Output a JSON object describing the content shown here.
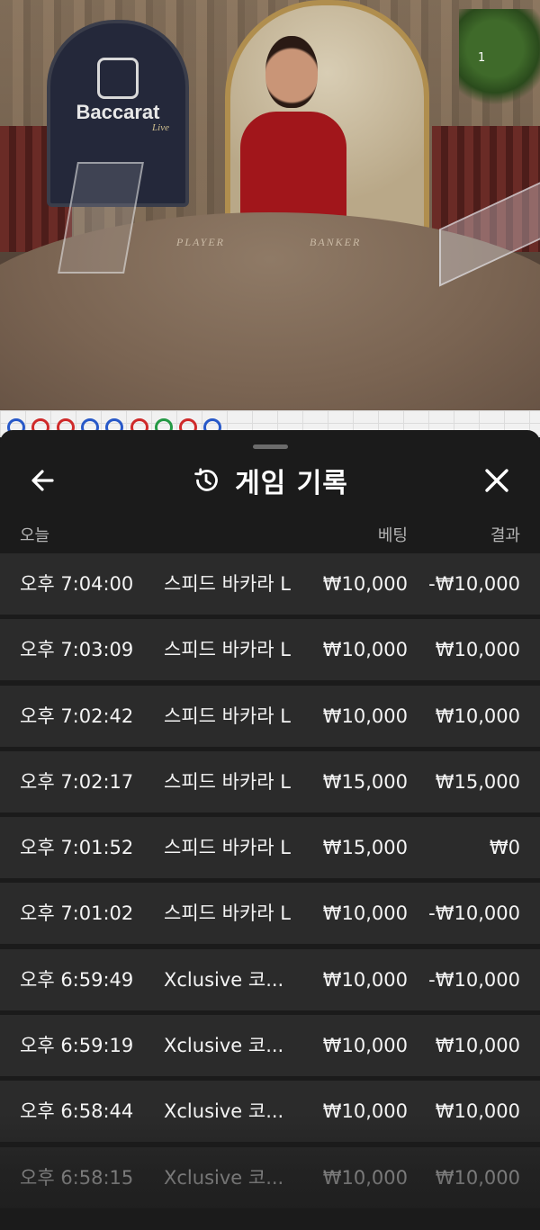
{
  "video": {
    "table_logo_text": "Baccarat",
    "table_logo_sub": "Live",
    "player_label": "PLAYER",
    "banker_label": "BANKER",
    "viewer_count": "1"
  },
  "bead_road": [
    "P",
    "B",
    "B",
    "P",
    "P",
    "B",
    "T",
    "B",
    "P"
  ],
  "colors": {
    "sheet_bg": "#1b1b1b",
    "row_bg": "#2b2b2b",
    "player_blue": "#2758c8",
    "banker_red": "#cf2a2a",
    "tie_green": "#239944"
  },
  "header": {
    "title": "게임 기록",
    "back_icon": "arrow-left-icon",
    "history_icon": "history-clock-icon",
    "close_icon": "close-x-icon"
  },
  "columns": {
    "date": "오늘",
    "bet": "베팅",
    "result": "결과"
  },
  "rows": [
    {
      "time": "오후 7:04:00",
      "game": "스피드 바카라 L",
      "bet": "₩10,000",
      "result": "-₩10,000"
    },
    {
      "time": "오후 7:03:09",
      "game": "스피드 바카라 L",
      "bet": "₩10,000",
      "result": "₩10,000"
    },
    {
      "time": "오후 7:02:42",
      "game": "스피드 바카라 L",
      "bet": "₩10,000",
      "result": "₩10,000"
    },
    {
      "time": "오후 7:02:17",
      "game": "스피드 바카라 L",
      "bet": "₩15,000",
      "result": "₩15,000"
    },
    {
      "time": "오후 7:01:52",
      "game": "스피드 바카라 L",
      "bet": "₩15,000",
      "result": "₩0"
    },
    {
      "time": "오후 7:01:02",
      "game": "스피드 바카라 L",
      "bet": "₩10,000",
      "result": "-₩10,000"
    },
    {
      "time": "오후 6:59:49",
      "game": "Xclusive 코...",
      "bet": "₩10,000",
      "result": "-₩10,000"
    },
    {
      "time": "오후 6:59:19",
      "game": "Xclusive 코...",
      "bet": "₩10,000",
      "result": "₩10,000"
    },
    {
      "time": "오후 6:58:44",
      "game": "Xclusive 코...",
      "bet": "₩10,000",
      "result": "₩10,000"
    },
    {
      "time": "오후 6:58:15",
      "game": "Xclusive 코...",
      "bet": "₩10,000",
      "result": "₩10,000"
    }
  ]
}
